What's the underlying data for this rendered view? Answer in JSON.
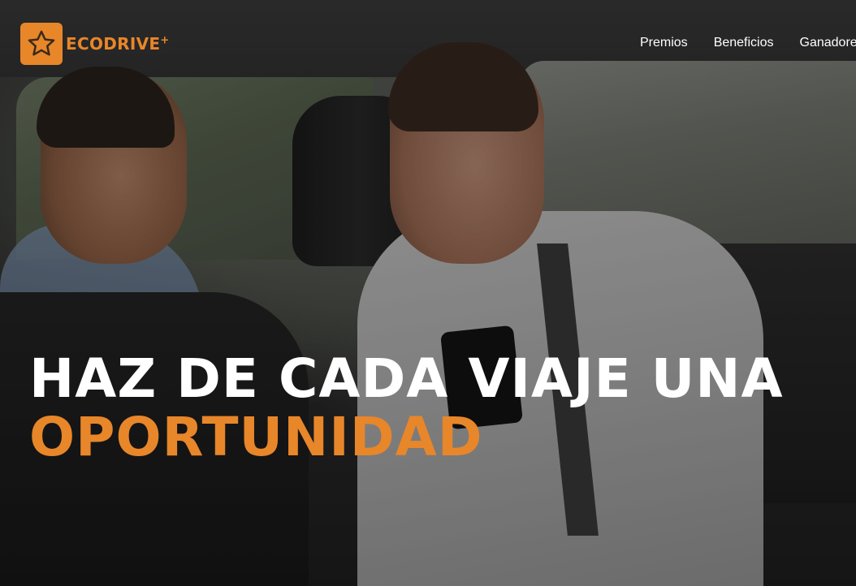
{
  "brand": {
    "name": "ECODRIVE",
    "suffix": "+",
    "accent_color": "#e8862a",
    "icon": "star-icon"
  },
  "nav": {
    "items": [
      {
        "label": "Premios"
      },
      {
        "label": "Beneficios"
      },
      {
        "label": "Ganadores"
      }
    ]
  },
  "hero": {
    "headline_line1": "HAZ DE CADA VIAJE UNA",
    "headline_line2": "OPORTUNIDAD",
    "headline_color": "#ffffff",
    "highlight_color": "#e8862a"
  }
}
